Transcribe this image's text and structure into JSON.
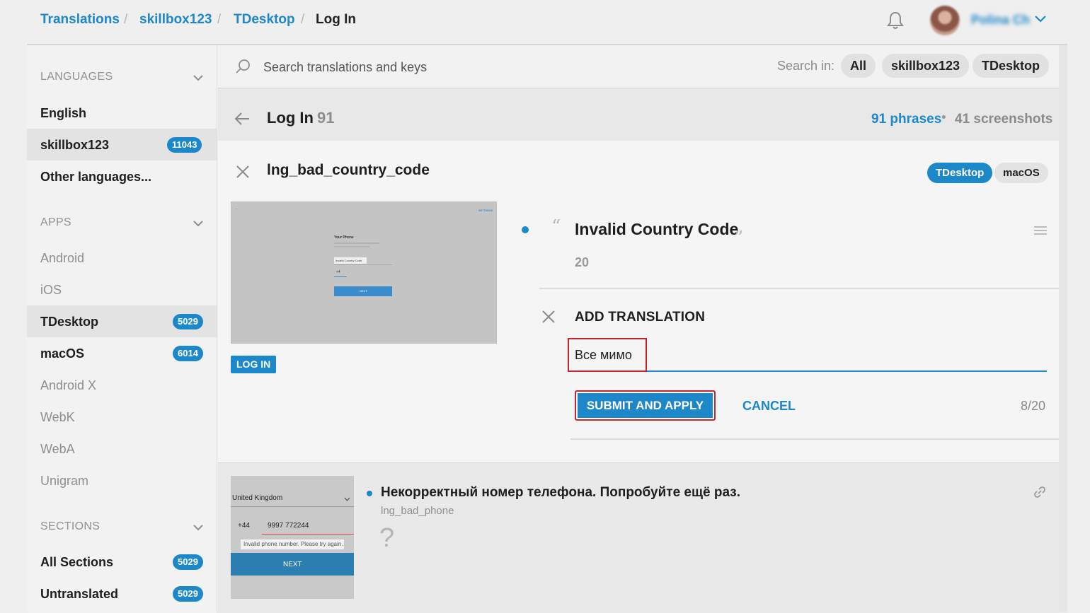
{
  "breadcrumb": [
    "Translations",
    "skillbox123",
    "TDesktop",
    "Log In"
  ],
  "breadcrumb_sep": "/",
  "user": {
    "name": "Polina Ch"
  },
  "sidebar": {
    "languages_label": "LANGUAGES",
    "languages": [
      {
        "label": "English"
      },
      {
        "label": "skillbox123",
        "badge": "11043",
        "selected": true
      },
      {
        "label": "Other languages..."
      }
    ],
    "apps_label": "APPS",
    "apps": [
      {
        "label": "Android"
      },
      {
        "label": "iOS"
      },
      {
        "label": "TDesktop",
        "badge": "5029",
        "selected": true
      },
      {
        "label": "macOS",
        "badge": "6014"
      },
      {
        "label": "Android X"
      },
      {
        "label": "WebK"
      },
      {
        "label": "WebA"
      },
      {
        "label": "Unigram"
      }
    ],
    "sections_label": "SECTIONS",
    "sections": [
      {
        "label": "All Sections",
        "badge": "5029"
      },
      {
        "label": "Untranslated",
        "badge": "5029"
      }
    ]
  },
  "search": {
    "placeholder": "Search translations and keys",
    "search_in_label": "Search in:",
    "scopes": [
      "All",
      "skillbox123",
      "TDesktop"
    ]
  },
  "section": {
    "title": "Log In",
    "count": "91",
    "phrases_link": "91 phrases",
    "dot": "•",
    "screenshots": "41 screenshots"
  },
  "key": {
    "name": "lng_bad_country_code",
    "tags": [
      "TDesktop",
      "macOS"
    ],
    "screenshot_button": "LOG IN",
    "source_text": "Invalid Country Code",
    "char_limit": "20",
    "quote_open": "“",
    "quote_close": "”",
    "add_translation_label": "ADD TRANSLATION",
    "translation_value": "Все мимо",
    "submit_label": "SUBMIT AND APPLY",
    "cancel_label": "CANCEL",
    "char_count": "8/20"
  },
  "screenshot1": {
    "title": "Your Phone",
    "field": "Invalid Country Code",
    "code": "+4",
    "next": "NEXT",
    "settings": "SETTINGS"
  },
  "next_entry": {
    "text": "Некорректный номер телефона. Попробуйте ещё раз.",
    "key": "lng_bad_phone",
    "placeholder": "?"
  },
  "screenshot2": {
    "country": "United Kingdom",
    "code": "+44",
    "phone": "9997 772244",
    "error": "Invalid phone number. Please try again.",
    "next": "NEXT"
  },
  "colors": {
    "accent": "#1c87c9",
    "highlight": "#c6252c"
  }
}
